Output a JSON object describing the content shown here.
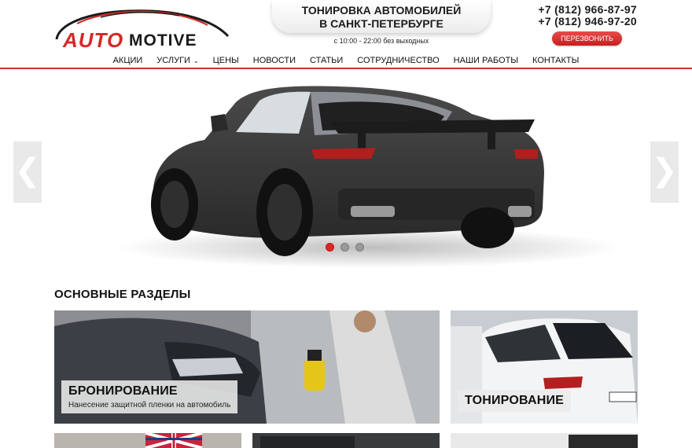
{
  "brand": {
    "logo_primary": "AUTO",
    "logo_secondary": "MOTIVE"
  },
  "header": {
    "slogan_line1": "ТОНИРОВКА АВТОМОБИЛЕЙ",
    "slogan_line2": "В САНКТ-ПЕТЕРБУРГЕ",
    "hours": "с 10:00 - 22:00 без выходных",
    "phone1": "+7 (812) 966-87-97",
    "phone2": "+7 (812) 946-97-20",
    "callback_label": "ПЕРЕЗВОНИТЬ"
  },
  "nav": {
    "items": [
      {
        "label": "АКЦИИ"
      },
      {
        "label": "УСЛУГИ"
      },
      {
        "label": "ЦЕНЫ"
      },
      {
        "label": "НОВОСТИ"
      },
      {
        "label": "СТАТЬИ"
      },
      {
        "label": "СОТРУДНИЧЕСТВО"
      },
      {
        "label": "НАШИ РАБОТЫ"
      },
      {
        "label": "КОНТАКТЫ"
      }
    ],
    "dropdown_icon": "chevron-down-icon"
  },
  "slider": {
    "prev_glyph": "❮",
    "next_glyph": "❯",
    "slide_count": 3,
    "active_slide": 1
  },
  "sections": {
    "title": "ОСНОВНЫЕ РАЗДЕЛЫ",
    "cards": [
      {
        "title": "БРОНИРОВАНИЕ",
        "subtitle": "Нанесение защитной пленки на автомобиль"
      },
      {
        "title": "ТОНИРОВАНИЕ"
      }
    ]
  },
  "colors": {
    "accent": "#d32f2f",
    "nav_border": "#d32f2f",
    "dot_active": "#e02626",
    "dot_inactive": "#9a9a9a"
  }
}
